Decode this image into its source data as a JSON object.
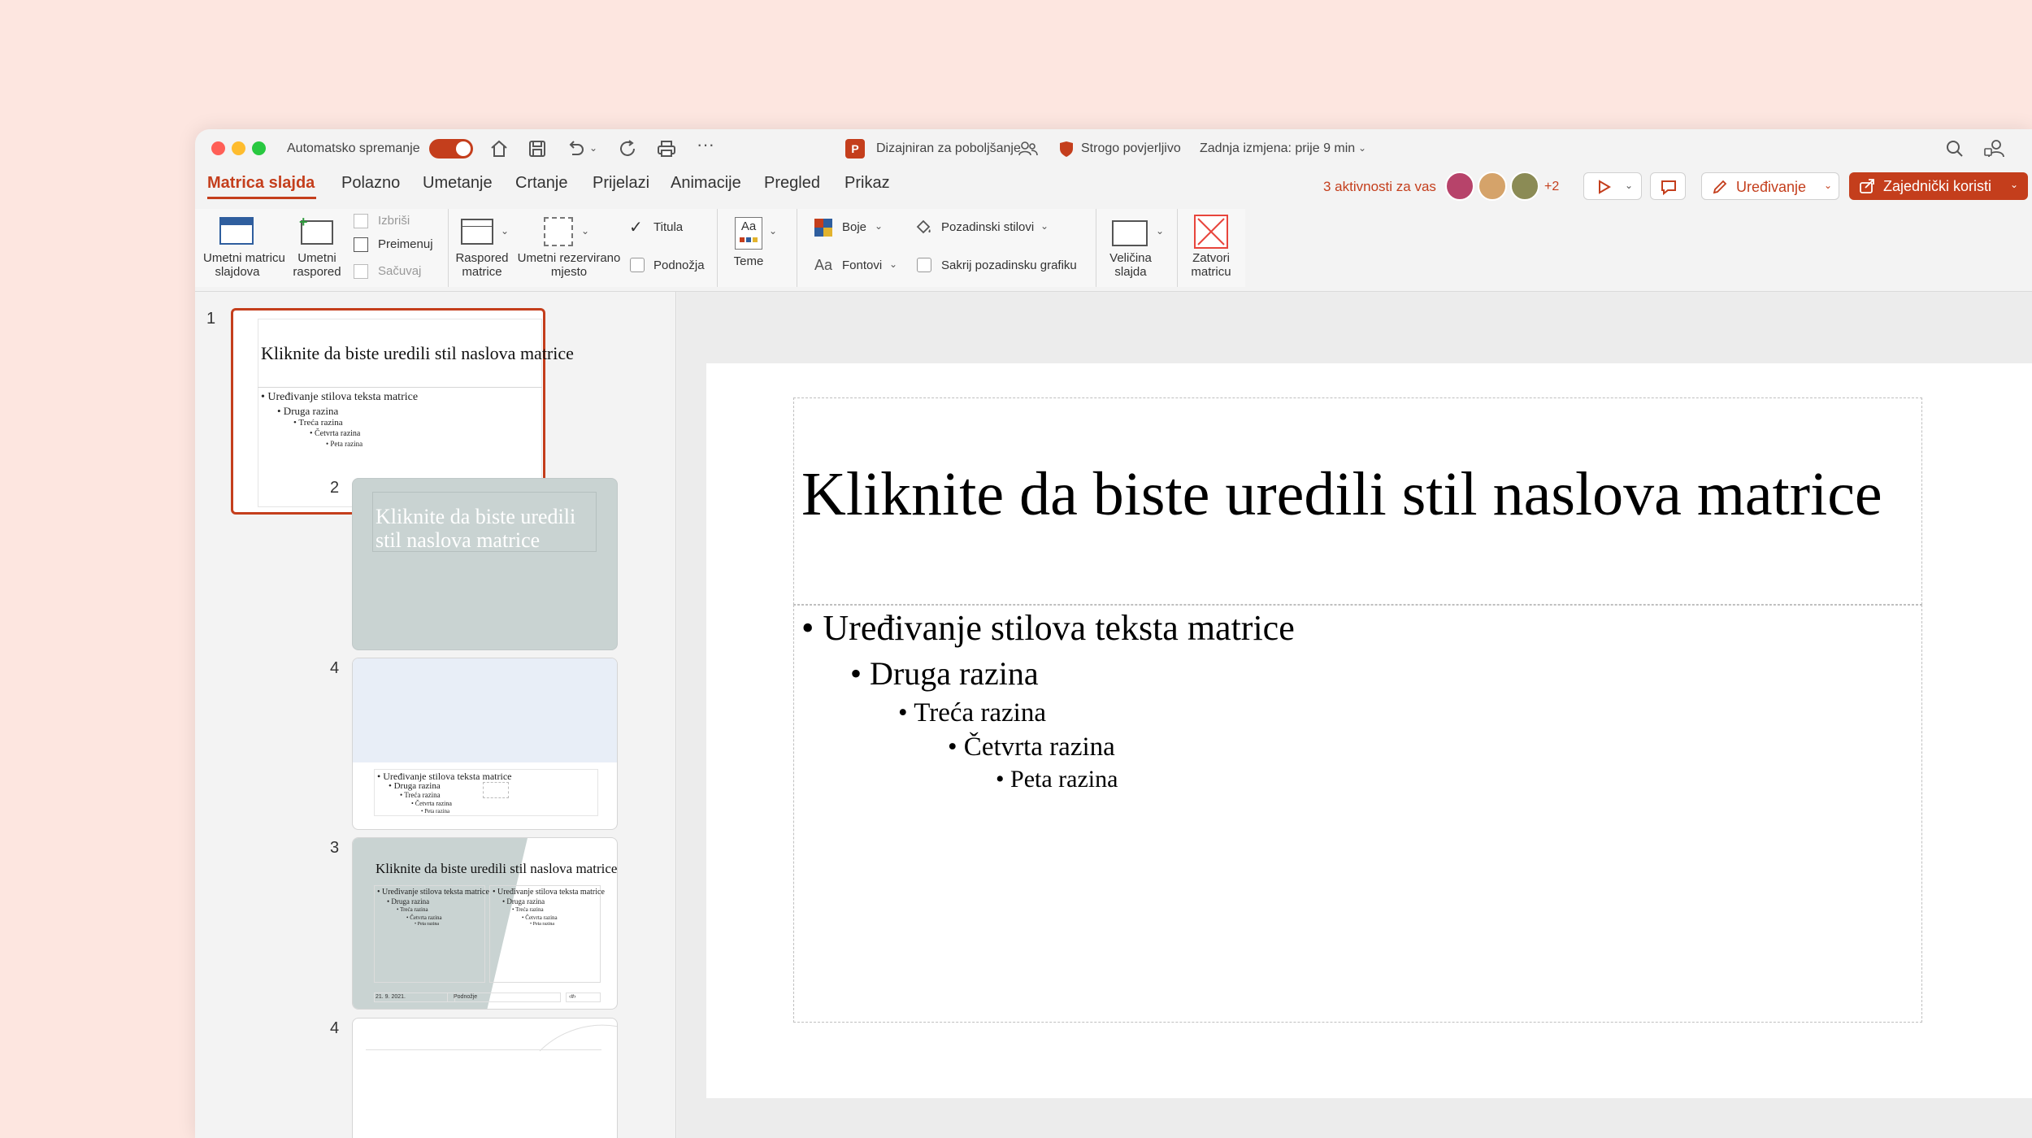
{
  "titlebar": {
    "autosave_label": "Automatsko spremanje",
    "doc_title": "Dizajniran za poboljšanje",
    "sensitivity": "Strogo povjerljivo",
    "last_modified": "Zadnja izmjena: prije 9 min"
  },
  "tabs": [
    "Matrica slajda",
    "Polazno",
    "Umetanje",
    "Crtanje",
    "Prijelazi",
    "Animacije",
    "Pregled",
    "Prikaz"
  ],
  "activity": {
    "label": "3 aktivnosti za vas",
    "more": "+2"
  },
  "buttons": {
    "edit": "Uređivanje",
    "share": "Zajednički koristi"
  },
  "ribbon": {
    "insert_master": [
      "Umetni matricu",
      "slajdova"
    ],
    "insert_layout": [
      "Umetni",
      "raspored"
    ],
    "delete": "Izbriši",
    "rename": "Preimenuj",
    "preserve": "Sačuvaj",
    "master_layout": [
      "Raspored",
      "matrice"
    ],
    "insert_placeholder": [
      "Umetni rezervirano",
      "mjesto"
    ],
    "title": "Titula",
    "footers": "Podnožja",
    "themes": "Teme",
    "colors": "Boje",
    "fonts": "Fontovi",
    "bg_styles": "Pozadinski stilovi",
    "hide_bg": "Sakrij pozadinsku grafiku",
    "slide_size": [
      "Veličina",
      "slajda"
    ],
    "close_master": [
      "Zatvori",
      "matricu"
    ]
  },
  "thumbnails": [
    {
      "num": "1",
      "title": "Kliknite da biste uredili stil naslova matrice",
      "bullets": [
        "• Uređivanje stilova teksta matrice",
        "• Druga razina",
        "• Treća razina",
        "• Četvrta razina",
        "• Peta razina"
      ]
    },
    {
      "num": "2",
      "title": "Kliknite da biste uredili stil naslova matrice"
    },
    {
      "num": "4",
      "bullets": [
        "• Uređivanje stilova teksta matrice",
        "• Druga razina",
        "• Treća razina",
        "• Četvrta razina",
        "• Peta razina"
      ]
    },
    {
      "num": "3",
      "title": "Kliknite da biste uredili stil naslova matrice",
      "bullets": [
        "• Uređivanje stilova teksta matrice",
        "• Druga razina",
        "• Treća razina",
        "• Četvrta razina",
        "• Peta razina"
      ],
      "date": "21. 9. 2021.",
      "footer": "Podnožje",
      "page": "‹#›"
    },
    {
      "num": "4"
    }
  ],
  "slide": {
    "title": "Kliknite da biste uredili stil naslova matrice",
    "bullets": [
      "• Uređivanje stilova teksta matrice",
      "• Druga razina",
      "• Treća razina",
      "• Četvrta razina",
      "• Peta razina"
    ]
  },
  "colors": {
    "accent": "#c43e1c",
    "close": "#e8453c",
    "toggle": "#c43e1c"
  }
}
